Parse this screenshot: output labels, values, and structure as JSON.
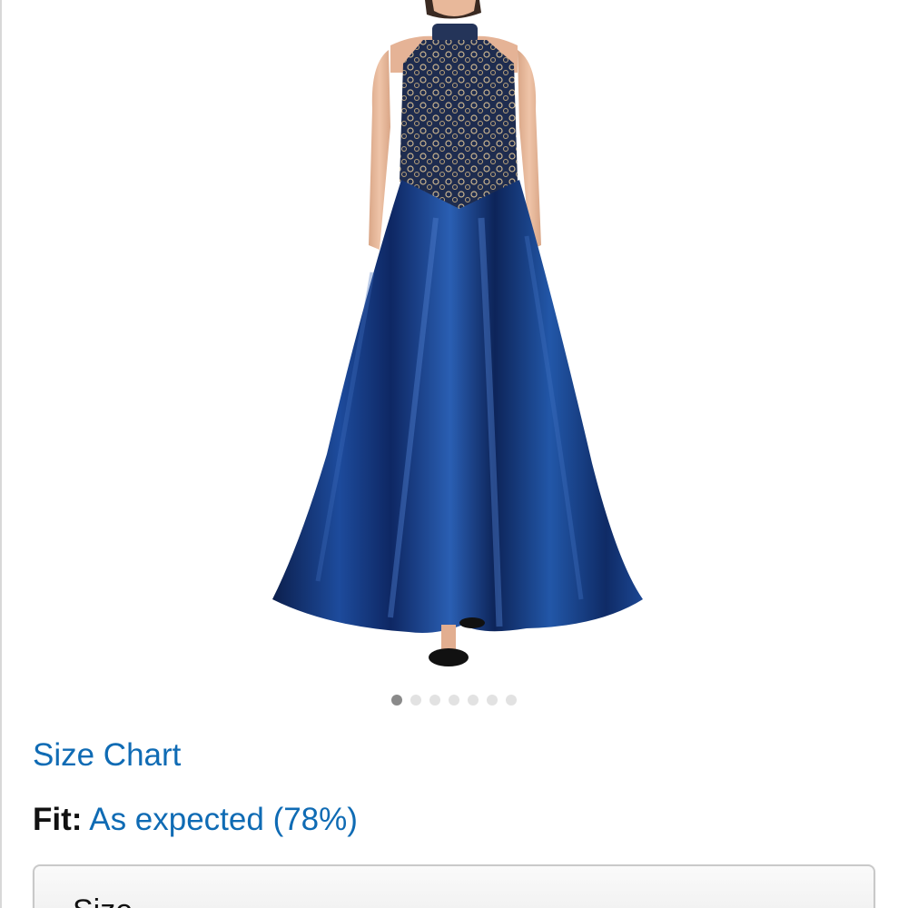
{
  "product": {
    "image_alt": "Navy blue halter lace-bodice satin ball gown",
    "carousel": {
      "total": 7,
      "active": 0
    }
  },
  "links": {
    "size_chart": "Size Chart"
  },
  "fit": {
    "label": "Fit:",
    "value": "As expected (78%)"
  },
  "size_selector": {
    "label": "Size"
  },
  "colors": {
    "link": "#0f6bb4",
    "dress_main": "#14357a",
    "dot_active": "#8a8a8a",
    "dot_inactive": "#e2e2e2"
  }
}
